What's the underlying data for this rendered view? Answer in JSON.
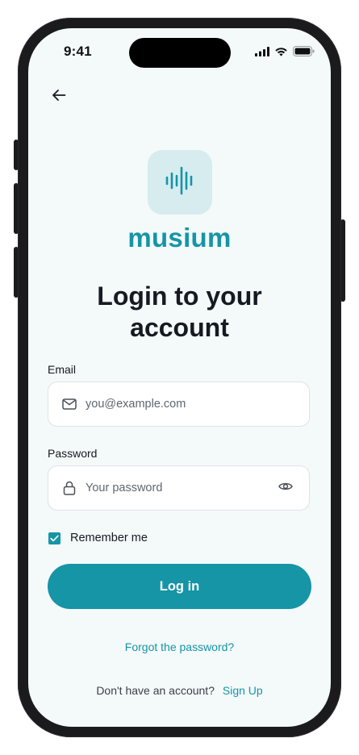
{
  "status_bar": {
    "time": "9:41",
    "icons": [
      "signal-icon",
      "wifi-icon",
      "battery-icon"
    ]
  },
  "nav": {
    "back_icon": "arrow-left-icon"
  },
  "brand": {
    "logo_icon": "sound-wave-icon",
    "name": "musium"
  },
  "page": {
    "title_line1": "Login to your",
    "title_line2": "account"
  },
  "form": {
    "email": {
      "label": "Email",
      "value": "",
      "placeholder": "you@example.com",
      "icon": "mail-icon"
    },
    "password": {
      "label": "Password",
      "value": "",
      "placeholder": "Your password",
      "icon": "lock-icon",
      "toggle_icon": "eye-icon"
    },
    "remember": {
      "label": "Remember me",
      "checked": true
    },
    "submit_label": "Log in",
    "forgot_label": "Forgot the password?"
  },
  "footer": {
    "prompt": "Don't have an account?",
    "signup_label": "Sign Up"
  },
  "colors": {
    "accent": "#1595a6",
    "logo_bg": "#d6ecef",
    "screen_bg": "#f4f9fa",
    "text": "#161a22",
    "device": "#1b1b1d"
  }
}
